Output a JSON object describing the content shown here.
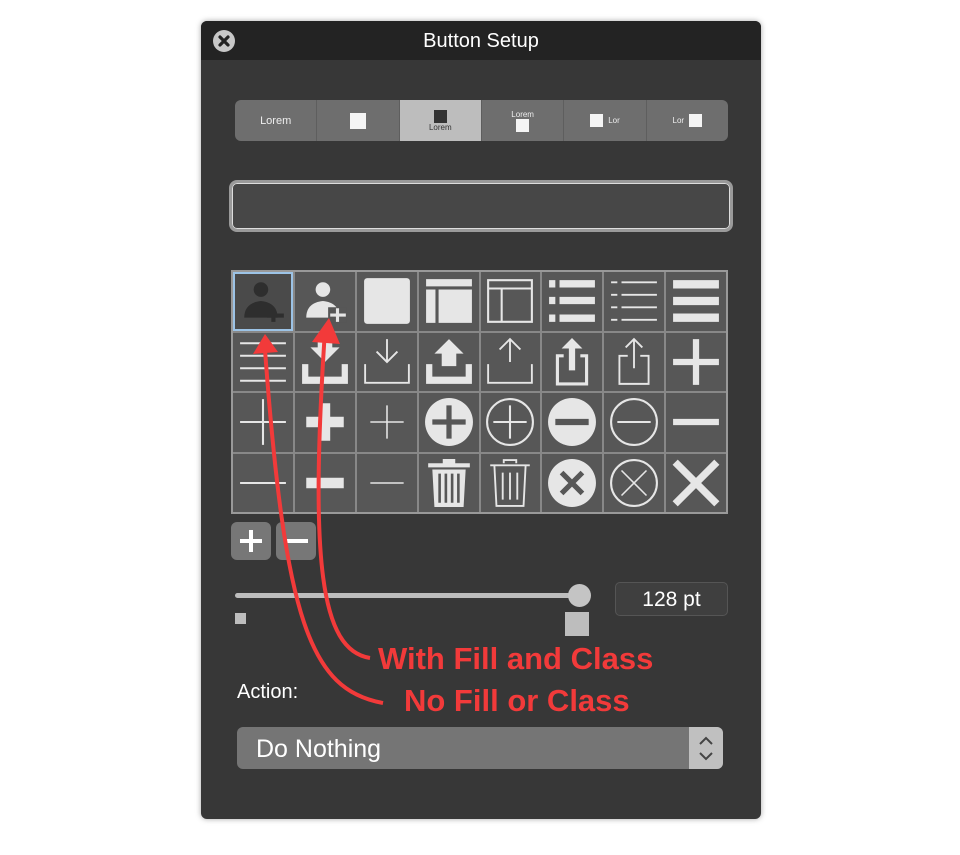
{
  "window": {
    "title": "Button Setup",
    "close_icon": "close-circle-icon"
  },
  "segmented": {
    "items": [
      {
        "style": "text-only",
        "label": "Lorem"
      },
      {
        "style": "icon-only",
        "label": ""
      },
      {
        "style": "icon-above-text",
        "label": "Lorem",
        "selected": true
      },
      {
        "style": "text-above-icon",
        "label": "Lorem"
      },
      {
        "style": "icon-left-text",
        "label": "Lor"
      },
      {
        "style": "text-left-icon",
        "label": "Lor"
      }
    ]
  },
  "text_field": {
    "value": ""
  },
  "icon_grid": {
    "selected_index": 0,
    "icons": [
      "person-add-filled-icon",
      "person-add-icon",
      "square-filled-icon",
      "layout-filled-icon",
      "layout-outline-icon",
      "list-bullet-filled-icon",
      "list-bullet-thin-icon",
      "menu-thick-icon",
      "lines-thin-icon",
      "download-filled-icon",
      "download-outline-icon",
      "upload-filled-icon",
      "upload-outline-icon",
      "share-filled-icon",
      "share-outline-icon",
      "plus-thick-icon",
      "plus-long-thin-icon",
      "plus-small-thick-icon",
      "plus-thin-icon",
      "plus-circle-filled-icon",
      "plus-circle-outline-icon",
      "minus-circle-filled-icon",
      "minus-circle-outline-icon",
      "minus-thick-icon",
      "minus-long-thin-icon",
      "minus-small-thick-icon",
      "minus-thin-icon",
      "trash-filled-icon",
      "trash-outline-icon",
      "x-circle-filled-icon",
      "x-circle-outline-icon",
      "x-thick-icon"
    ]
  },
  "grid_buttons": {
    "add_icon": "plus-icon",
    "remove_icon": "minus-icon"
  },
  "size": {
    "slider_fraction": 1.0,
    "value_text": "128 pt"
  },
  "action": {
    "label": "Action:",
    "selected": "Do Nothing"
  },
  "annotations": {
    "with_fill": "With Fill and Class",
    "no_fill": "No Fill or Class",
    "color": "#f23a3a"
  }
}
